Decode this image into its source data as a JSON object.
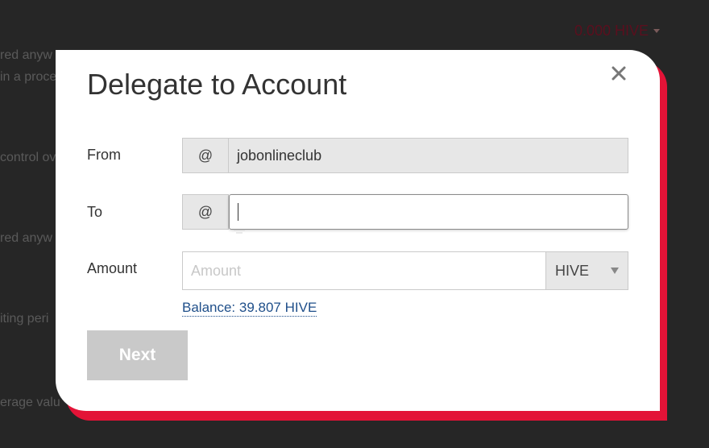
{
  "background": {
    "fragments": [
      "red anyw",
      "in a proce",
      "control ov",
      "red anyw",
      "iting peri",
      "erage valu"
    ],
    "balance": "0.000 HIVE"
  },
  "modal": {
    "title": "Delegate to Account",
    "close_glyph": "×",
    "from": {
      "label": "From",
      "addon": "@",
      "value": "jobonlineclub"
    },
    "to": {
      "label": "To",
      "addon": "@",
      "value": ""
    },
    "amount": {
      "label": "Amount",
      "placeholder": "Amount",
      "asset_selected": "HIVE",
      "asset_options": [
        "HIVE"
      ]
    },
    "balance_link": "Balance: 39.807 HIVE",
    "next_button": "Next"
  },
  "colors": {
    "accent": "#e31337",
    "link": "#1f4f8a",
    "disabled_button": "#c9c9c9"
  }
}
